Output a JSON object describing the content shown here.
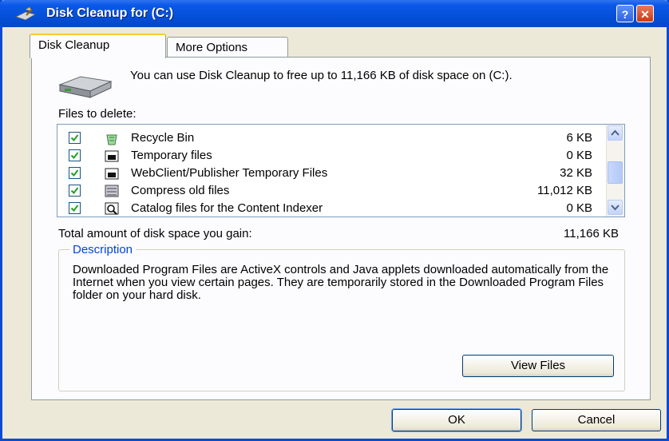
{
  "window": {
    "title": "Disk Cleanup for  (C:)",
    "help_label": "?",
    "close_label": "✕"
  },
  "tabs": [
    {
      "label": "Disk Cleanup",
      "active": true
    },
    {
      "label": "More Options",
      "active": false
    }
  ],
  "intro": {
    "text": "You can use Disk Cleanup to free up to 11,166 KB of disk space on  (C:)."
  },
  "files": {
    "label": "Files to delete:",
    "items": [
      {
        "name": "Recycle Bin",
        "size": "6 KB",
        "checked": true,
        "icon": "recycle-bin-icon"
      },
      {
        "name": "Temporary files",
        "size": "0 KB",
        "checked": true,
        "icon": "temp-files-icon"
      },
      {
        "name": "WebClient/Publisher Temporary Files",
        "size": "32 KB",
        "checked": true,
        "icon": "webclient-files-icon"
      },
      {
        "name": "Compress old files",
        "size": "11,012 KB",
        "checked": true,
        "icon": "compress-files-icon"
      },
      {
        "name": "Catalog files for the Content Indexer",
        "size": "0 KB",
        "checked": true,
        "icon": "catalog-files-icon"
      }
    ]
  },
  "total": {
    "label": "Total amount of disk space you gain:",
    "value": "11,166 KB"
  },
  "description": {
    "legend": "Description",
    "text": "Downloaded Program Files are ActiveX controls and Java applets downloaded automatically from the Internet when you view certain pages. They are temporarily stored in the Downloaded Program Files folder on your hard disk."
  },
  "buttons": {
    "view_files": "View Files",
    "ok": "OK",
    "cancel": "Cancel"
  }
}
